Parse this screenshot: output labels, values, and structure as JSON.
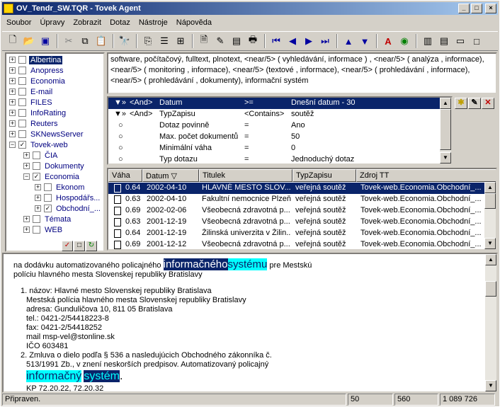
{
  "window": {
    "title": "OV_Tendr_SW.TQR - Tovek Agent",
    "controls": {
      "minimize": "_",
      "maximize": "□",
      "close": "×"
    }
  },
  "menu": [
    "Soubor",
    "Úpravy",
    "Zobrazit",
    "Dotaz",
    "Nástroje",
    "Nápověda"
  ],
  "tree": {
    "items": [
      {
        "label": "Albertina",
        "expand": "+",
        "check": "",
        "selected": true
      },
      {
        "label": "Anopress",
        "expand": "+",
        "check": ""
      },
      {
        "label": "Economia",
        "expand": "+",
        "check": ""
      },
      {
        "label": "E-mail",
        "expand": "+",
        "check": ""
      },
      {
        "label": "FILES",
        "expand": "+",
        "check": ""
      },
      {
        "label": "InfoRating",
        "expand": "+",
        "check": ""
      },
      {
        "label": "Reuters",
        "expand": "+",
        "check": ""
      },
      {
        "label": "SKNewsServer",
        "expand": "+",
        "check": ""
      },
      {
        "label": "Tovek-web",
        "expand": "−",
        "check": "✓"
      },
      {
        "label": "ČIA",
        "expand": "+",
        "check": ""
      },
      {
        "label": "Dokumenty",
        "expand": "+",
        "check": ""
      },
      {
        "label": "Economia",
        "expand": "−",
        "check": "✓"
      },
      {
        "label": "Ekonom",
        "expand": "+",
        "check": ""
      },
      {
        "label": "Hospodářs...",
        "expand": "+",
        "check": ""
      },
      {
        "label": "Obchodní_...",
        "expand": "+",
        "check": "✓"
      },
      {
        "label": "Témata",
        "expand": "+",
        "check": ""
      },
      {
        "label": "WEB",
        "expand": "+",
        "check": ""
      }
    ],
    "buttons": [
      "✓",
      "□",
      "↻"
    ]
  },
  "query": {
    "text": "software, počítačový, fulltext, plnotext, <near/5> ( vyhledávání, informace ) , <near/5> ( analýza , informace), <near/5> ( monitoring , informace), <near/5> (textové , informace), <near/5> ( prohledávání , informace), <near/5> ( prohledávání , dokumenty), informační systém"
  },
  "criteria": {
    "rows": [
      {
        "icon": "▼»",
        "op": "<And>",
        "field": "Datum",
        "cmp": ">=",
        "value": "Dnešní datum - 30",
        "selected": true
      },
      {
        "icon": "▼»",
        "op": "<And>",
        "field": "TypZapisu",
        "cmp": "<Contains>",
        "value": "soutěž"
      },
      {
        "icon": "○",
        "op": "",
        "field": "Dotaz povinně",
        "cmp": "=",
        "value": "Ano"
      },
      {
        "icon": "○",
        "op": "",
        "field": "Max. počet dokumentů",
        "cmp": "=",
        "value": "50"
      },
      {
        "icon": "○",
        "op": "",
        "field": "Minimální váha",
        "cmp": "=",
        "value": "0"
      },
      {
        "icon": "○",
        "op": "",
        "field": "Typ dotazu",
        "cmp": "=",
        "value": "Jednoduchý dotaz"
      }
    ],
    "buttons": [
      "✱",
      "✎",
      "✕"
    ]
  },
  "results": {
    "columns": [
      "Váha",
      "Datum ▽",
      "Titulek",
      "TypZapisu",
      "Zdroj TT"
    ],
    "rows": [
      {
        "vaha": "0.64",
        "datum": "2002-04-10",
        "titulek": "HLAVNÉ MESTO SLOV...",
        "typ": "veřejná soutěž",
        "zdroj": "Tovek-web.Economia.Obchodní_...",
        "selected": true
      },
      {
        "vaha": "0.63",
        "datum": "2002-04-10",
        "titulek": "Fakultní nemocnice Plzeň",
        "typ": "veřejná soutěž",
        "zdroj": "Tovek-web.Economia.Obchodní_..."
      },
      {
        "vaha": "0.69",
        "datum": "2002-02-06",
        "titulek": "Všeobecná zdravotná p...",
        "typ": "veřejná soutěž",
        "zdroj": "Tovek-web.Economia.Obchodní_..."
      },
      {
        "vaha": "0.63",
        "datum": "2001-12-19",
        "titulek": "Všeobecná zdravotná p...",
        "typ": "veřejná soutěž",
        "zdroj": "Tovek-web.Economia.Obchodní_..."
      },
      {
        "vaha": "0.64",
        "datum": "2001-12-19",
        "titulek": "Žilinská univerzita v Žilin...",
        "typ": "veřejná soutěž",
        "zdroj": "Tovek-web.Economia.Obchodní_..."
      },
      {
        "vaha": "0.69",
        "datum": "2001-12-12",
        "titulek": "Všeobecná zdravotná p...",
        "typ": "veřejná soutěž",
        "zdroj": "Tovek-web.Economia.Obchodní_..."
      }
    ]
  },
  "viewer": {
    "p1_before": "na dodávku automatizovaného policajného ",
    "p1_hl1": "informačného",
    "p1_hl2": "systému",
    "p1_after": " pre Mestskú",
    "p2": "políciu hlavného mesta Slovenskej republiky Bratislavy",
    "p3": "1. názov: Hlavné mesto Slovenskej republiky Bratislava",
    "p4": "Mestská polícia hlavného mesta Slovenskej republiky Bratislavy",
    "p5": "adresa: Gunduličova 10, 811 05 Bratislava",
    "p6": "tel.: 0421-2/54418223-8",
    "p7": "fax: 0421-2/54418252",
    "p8": "mail msp-vel@stonline.sk",
    "p9": "IČO 603481",
    "p10": "2. Zmluva o dielo podľa § 536 a nasledujúcich Obchodného zákonníka č.",
    "p11": "513/1991 Zb., v znení neskorších predpisov. Automatizovaný policajný",
    "p12_hl1": "informačný",
    "p12_hl2": "systém",
    "p12_after": ".",
    "p13": "KP 72.20.22, 72.20.32"
  },
  "status": {
    "text": "Připraven.",
    "c1": "50",
    "c2": "560",
    "c3": "1 089 726"
  }
}
